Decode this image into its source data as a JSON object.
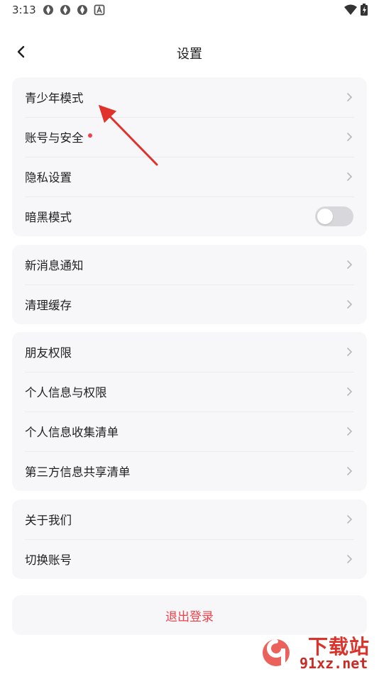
{
  "status_bar": {
    "time": "3:13"
  },
  "header": {
    "title": "设置"
  },
  "groups": [
    {
      "items": [
        {
          "label": "青少年模式"
        },
        {
          "label": "账号与安全",
          "dot": true
        },
        {
          "label": "隐私设置"
        },
        {
          "label": "暗黑模式",
          "toggle": "off"
        }
      ]
    },
    {
      "items": [
        {
          "label": "新消息通知"
        },
        {
          "label": "清理缓存"
        }
      ]
    },
    {
      "items": [
        {
          "label": "朋友权限"
        },
        {
          "label": "个人信息与权限"
        },
        {
          "label": "个人信息收集清单"
        },
        {
          "label": "第三方信息共享清单"
        }
      ]
    },
    {
      "items": [
        {
          "label": "关于我们"
        },
        {
          "label": "切换账号"
        }
      ]
    }
  ],
  "logout": {
    "label": "退出登录"
  },
  "watermark": {
    "title": "下载站",
    "url": "91xz.net"
  },
  "colors": {
    "accent_red": "#f0424a",
    "group_bg": "#f7f7f9",
    "toggle_off": "#d8d8dc"
  },
  "icons": [
    "back-icon",
    "chevron-right-icon",
    "toggle-switch",
    "wifi-icon",
    "battery-icon"
  ]
}
